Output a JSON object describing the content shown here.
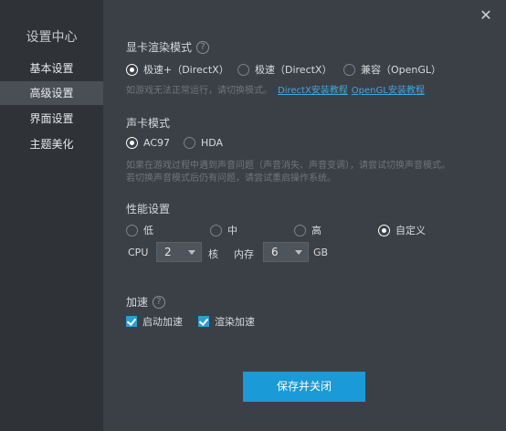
{
  "sidebar": {
    "title": "设置中心",
    "items": [
      {
        "label": "基本设置"
      },
      {
        "label": "高级设置"
      },
      {
        "label": "界面设置"
      },
      {
        "label": "主题美化"
      }
    ]
  },
  "close_label": "✕",
  "render": {
    "title": "显卡渲染模式",
    "options": [
      {
        "label": "极速+（DirectX）",
        "checked": true
      },
      {
        "label": "极速（DirectX）",
        "checked": false
      },
      {
        "label": "兼容（OpenGL）",
        "checked": false
      }
    ],
    "hint": "如游戏无法正常运行，请切换模式。",
    "link_directx": "DirectX安装教程",
    "link_opengl": "OpenGL安装教程"
  },
  "sound": {
    "title": "声卡模式",
    "options": [
      {
        "label": "AC97",
        "checked": true
      },
      {
        "label": "HDA",
        "checked": false
      }
    ],
    "hint_line1": "如果在游戏过程中遇到声音问题（声音消失、声音变调），请尝试切换声音模式。",
    "hint_line2": "若切换声音模式后仍有问题，请尝试重启操作系统。"
  },
  "performance": {
    "title": "性能设置",
    "options": [
      {
        "label": "低",
        "checked": false
      },
      {
        "label": "中",
        "checked": false
      },
      {
        "label": "高",
        "checked": false
      },
      {
        "label": "自定义",
        "checked": true
      }
    ],
    "cpu_label": "CPU",
    "cpu_value": "2",
    "cpu_unit": "核",
    "mem_label": "内存",
    "mem_value": "6",
    "mem_unit": "GB"
  },
  "accel": {
    "title": "加速",
    "options": [
      {
        "label": "启动加速",
        "checked": true
      },
      {
        "label": "渲染加速",
        "checked": true
      }
    ]
  },
  "save_label": "保存并关闭",
  "help_glyph": "?",
  "colors": {
    "accent": "#1a9ad6",
    "link": "#3fa8e0"
  }
}
